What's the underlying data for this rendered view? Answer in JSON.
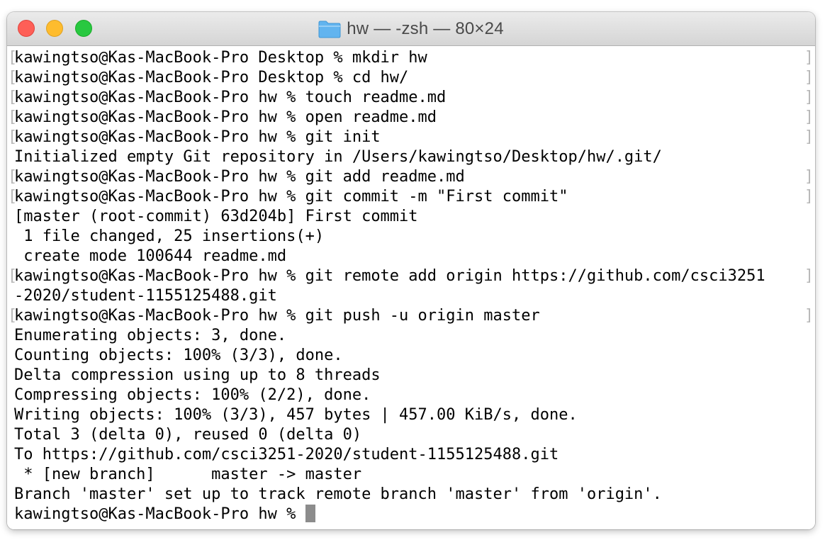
{
  "window": {
    "title": "hw — -zsh — 80×24",
    "folder_icon": "folder-icon"
  },
  "colors": {
    "close": "#fe5f57",
    "minimize": "#febc2e",
    "zoom": "#28c840",
    "folder": "#62b4ef",
    "cursor": "#8c8c8c",
    "mark": "#b8b8b8"
  },
  "terminal": {
    "lines": [
      {
        "text": "kawingtso@Kas-MacBook-Pro Desktop % mkdir hw",
        "marked": true
      },
      {
        "text": "kawingtso@Kas-MacBook-Pro Desktop % cd hw/",
        "marked": true
      },
      {
        "text": "kawingtso@Kas-MacBook-Pro hw % touch readme.md",
        "marked": true
      },
      {
        "text": "kawingtso@Kas-MacBook-Pro hw % open readme.md",
        "marked": true
      },
      {
        "text": "kawingtso@Kas-MacBook-Pro hw % git init",
        "marked": true
      },
      {
        "text": "Initialized empty Git repository in /Users/kawingtso/Desktop/hw/.git/",
        "marked": false
      },
      {
        "text": "kawingtso@Kas-MacBook-Pro hw % git add readme.md",
        "marked": true
      },
      {
        "text": "kawingtso@Kas-MacBook-Pro hw % git commit -m \"First commit\"",
        "marked": true
      },
      {
        "text": "[master (root-commit) 63d204b] First commit",
        "marked": false
      },
      {
        "text": " 1 file changed, 25 insertions(+)",
        "marked": false
      },
      {
        "text": " create mode 100644 readme.md",
        "marked": false
      },
      {
        "text": "kawingtso@Kas-MacBook-Pro hw % git remote add origin https://github.com/csci3251",
        "marked": true
      },
      {
        "text": "-2020/student-1155125488.git",
        "marked": false
      },
      {
        "text": "kawingtso@Kas-MacBook-Pro hw % git push -u origin master",
        "marked": true
      },
      {
        "text": "Enumerating objects: 3, done.",
        "marked": false
      },
      {
        "text": "Counting objects: 100% (3/3), done.",
        "marked": false
      },
      {
        "text": "Delta compression using up to 8 threads",
        "marked": false
      },
      {
        "text": "Compressing objects: 100% (2/2), done.",
        "marked": false
      },
      {
        "text": "Writing objects: 100% (3/3), 457 bytes | 457.00 KiB/s, done.",
        "marked": false
      },
      {
        "text": "Total 3 (delta 0), reused 0 (delta 0)",
        "marked": false
      },
      {
        "text": "To https://github.com/csci3251-2020/student-1155125488.git",
        "marked": false
      },
      {
        "text": " * [new branch]      master -> master",
        "marked": false
      },
      {
        "text": "Branch 'master' set up to track remote branch 'master' from 'origin'.",
        "marked": false
      }
    ],
    "prompt": "kawingtso@Kas-MacBook-Pro hw % ",
    "mark_left": "[",
    "mark_right": "]"
  }
}
